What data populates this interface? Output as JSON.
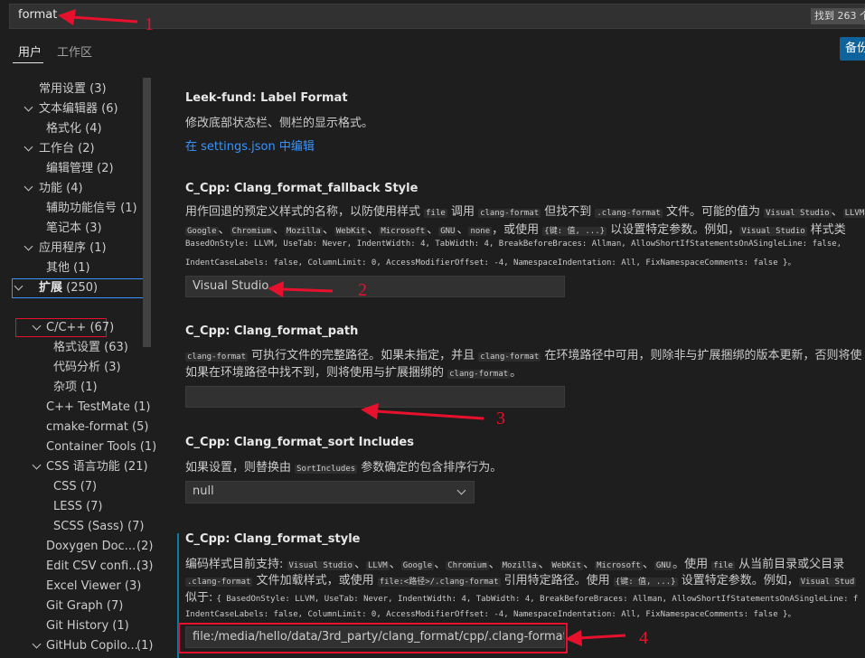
{
  "search": {
    "query": "format",
    "result_count": "找到 263 个"
  },
  "tabs": [
    {
      "label": "用户"
    },
    {
      "label": "工作区"
    }
  ],
  "backup_button": "备份",
  "tree": {
    "items": [
      {
        "label": "常用设置 (3)"
      },
      {
        "label": "文本编辑器 (6)"
      },
      {
        "label": "格式化 (4)"
      },
      {
        "label": "工作台 (2)"
      },
      {
        "label": "编辑管理 (2)"
      },
      {
        "label": "功能 (4)"
      },
      {
        "label": "辅助功能信号 (1)"
      },
      {
        "label": "笔记本 (3)"
      },
      {
        "label": "应用程序 (1)"
      },
      {
        "label": "其他 (1)"
      },
      {
        "label": "扩展",
        "count": "(250)"
      },
      {
        "label": "C/C++ (67)"
      },
      {
        "label": "格式设置 (63)"
      },
      {
        "label": "代码分析 (3)"
      },
      {
        "label": "杂项 (1)"
      },
      {
        "label": "C++ TestMate (1)"
      },
      {
        "label": "cmake-format (5)"
      },
      {
        "label": "Container Tools (1)"
      },
      {
        "label": "CSS 语言功能 (21)"
      },
      {
        "label": "CSS (7)"
      },
      {
        "label": "LESS (7)"
      },
      {
        "label": "SCSS (Sass) (7)"
      },
      {
        "label": "Doxygen Doc...",
        "count": "(2)"
      },
      {
        "label": "Edit CSV confi...",
        "count": "(3)"
      },
      {
        "label": "Excel Viewer (3)"
      },
      {
        "label": "Git Graph (7)"
      },
      {
        "label": "Git History (1)"
      },
      {
        "label": "GitHub Copilo...",
        "count": "(1)"
      }
    ]
  },
  "settings": {
    "label_format": {
      "prefix": "Leek-fund: ",
      "name": "Label Format",
      "desc": "修改底部状态栏、侧栏的显示格式。",
      "link": "在 settings.json 中编辑"
    },
    "fallback_style": {
      "prefix": "C_Cpp: ",
      "name": "Clang_format_fallback Style",
      "line1": [
        "用作回退的预定义样式的名称，以防使用样式 ",
        "file",
        " 调用 ",
        "clang-format",
        " 但找不到 ",
        ".clang-format",
        " 文件。可能的值为 ",
        "Visual Studio",
        "、",
        "LLVM"
      ],
      "line2": [
        "Google",
        "、",
        "Chromium",
        "、",
        "Mozilla",
        "、",
        "WebKit",
        "、",
        "Microsoft",
        "、",
        "GNU",
        "、",
        "none",
        "，或使用 ",
        "{键: 值, ...}",
        " 以设置特定参数。例如，",
        "Visual Studio",
        " 样式类"
      ],
      "line3": "BasedOnStyle: LLVM, UseTab: Never, IndentWidth: 4, TabWidth: 4, BreakBeforeBraces: Allman, AllowShortIfStatementsOnASingleLine: false,",
      "line4": "IndentCaseLabels: false, ColumnLimit: 0, AccessModifierOffset: -4, NamespaceIndentation: All, FixNamespaceComments: false }。",
      "value": "Visual Studio"
    },
    "format_path": {
      "prefix": "C_Cpp: ",
      "name": "Clang_format_path",
      "line1": [
        "clang-format",
        " 可执行文件的完整路径。如果未指定，并且 ",
        "clang-format",
        " 在环境路径中可用，则除非与扩展捆绑的版本更新，否则将使"
      ],
      "line2": [
        "如果在环境路径中找不到，则将使用与扩展捆绑的 ",
        "clang-format",
        "。"
      ],
      "value": ""
    },
    "sort_includes": {
      "prefix": "C_Cpp: ",
      "name": "Clang_format_sort Includes",
      "line1": [
        "如果设置，则替换由 ",
        "SortIncludes",
        " 参数确定的包含排序行为。"
      ],
      "value": "null"
    },
    "format_style": {
      "prefix": "C_Cpp: ",
      "name": "Clang_format_style",
      "line1": [
        "编码样式目前支持: ",
        "Visual Studio",
        "、",
        "LLVM",
        "、",
        "Google",
        "、",
        "Chromium",
        "、",
        "Mozilla",
        "、",
        "WebKit",
        "、",
        "Microsoft",
        "、",
        "GNU",
        "。使用 ",
        "file",
        " 从当前目录或父目录"
      ],
      "line2": [
        ".clang-format",
        " 文件加载样式，或使用 ",
        "file:<路径>/.clang-format",
        " 引用特定路径。使用 ",
        "{键: 值, ...}",
        " 设置特定参数。例如，",
        "Visual Stud"
      ],
      "line3_prefix": "似于: ",
      "line3": "{ BasedOnStyle: LLVM, UseTab: Never, IndentWidth: 4, TabWidth: 4, BreakBeforeBraces: Allman, AllowShortIfStatementsOnASingleLine: f",
      "line4": "IndentCaseLabels: false, ColumnLimit: 0, AccessModifierOffset: -4, NamespaceIndentation: All, FixNamespaceComments: false }。",
      "value": "file:/media/hello/data/3rd_party/clang_format/cpp/.clang-format"
    }
  },
  "annotations": [
    "1",
    "2",
    "3",
    "4"
  ],
  "colors": {
    "annotation": "#e8112d",
    "accent": "#3794ff",
    "button": "#0e639c"
  }
}
